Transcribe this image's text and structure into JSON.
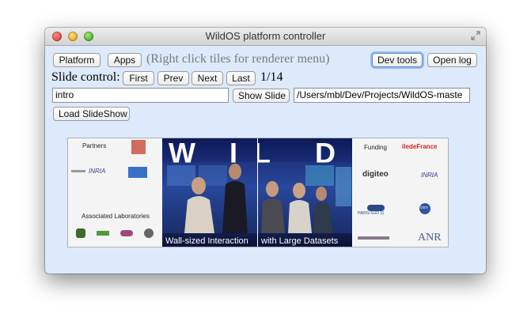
{
  "window": {
    "title": "WildOS platform controller"
  },
  "toolbar": {
    "platform_label": "Platform",
    "apps_label": "Apps",
    "hint": "(Right click tiles for renderer menu)",
    "devtools_label": "Dev tools",
    "openlog_label": "Open log"
  },
  "slide_control": {
    "label": "Slide control:",
    "first_label": "First",
    "prev_label": "Prev",
    "next_label": "Next",
    "last_label": "Last",
    "counter": "1/14"
  },
  "slide_input": {
    "value": "intro"
  },
  "show_slide_label": "Show Slide",
  "path_field": {
    "value": "/Users/mbl/Dev/Projects/WildOS-maste"
  },
  "load_slideshow_label": "Load SlideShow",
  "slide": {
    "partners_title": "Partners",
    "associated_title": "Associated   Laboratories",
    "funding_title": "Funding",
    "ile_de_france": "iledeFrance",
    "inria": "INRIA",
    "digiteo": "digiteo",
    "cnrs": "cnrs",
    "paris_sud": "PARIS-SUD 11",
    "anr": "ANR",
    "wild_letters": [
      "W",
      "I",
      "L",
      "D"
    ],
    "caption_left": "Wall-sized  Interaction",
    "caption_right": "with Large  Datasets"
  },
  "colors": {
    "window_bg": "#dceafb",
    "wall_blue": "#1c2f7a",
    "focus_ring": "#5a8ed8"
  }
}
